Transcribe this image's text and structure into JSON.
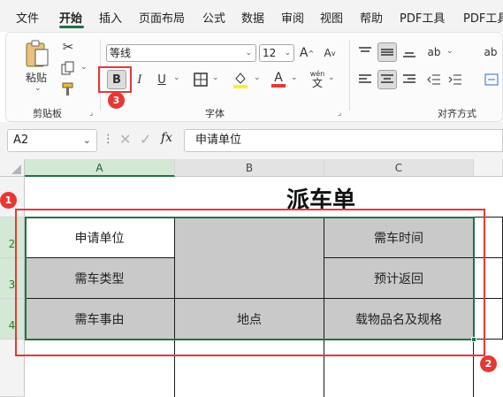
{
  "tabs": [
    "文件",
    "开始",
    "插入",
    "页面布局",
    "公式",
    "数据",
    "审阅",
    "视图",
    "帮助",
    "PDF工具",
    "PDF工具"
  ],
  "active_tab": "开始",
  "ribbon": {
    "clipboard": {
      "paste_label": "粘贴",
      "group_label": "剪贴板"
    },
    "font": {
      "font_name": "等线",
      "font_size": "12",
      "bold_label": "B",
      "italic_label": "I",
      "underline_label": "U",
      "font_color_label": "A",
      "group_label": "字体",
      "wen_label": "wén",
      "wen_char": "文",
      "grow_label": "A",
      "shrink_label": "A"
    },
    "alignment": {
      "group_label": "对齐方式",
      "ab_label": "ab"
    }
  },
  "formula_bar": {
    "name_box": "A2",
    "fx_label": "fx",
    "content": "申请单位"
  },
  "sheet": {
    "columns": [
      "A",
      "B",
      "C"
    ],
    "rows": [
      "1",
      "2",
      "3",
      "4"
    ],
    "title": "派车单",
    "table": [
      [
        "申请单位",
        "",
        "需车时间"
      ],
      [
        "需车类型",
        "",
        "预计返回"
      ],
      [
        "需车事由",
        "地点",
        "载物品名及规格"
      ]
    ]
  },
  "callouts": [
    "1",
    "2",
    "3"
  ],
  "colors": {
    "accent": "#1e7145",
    "callout": "#e53935",
    "cell_fill": "#c9c9c9",
    "selection": "#217346"
  }
}
